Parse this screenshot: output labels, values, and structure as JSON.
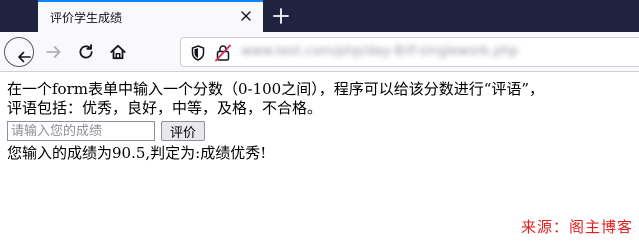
{
  "browser": {
    "tab_title": "评价学生成绩",
    "url_blurred": "www.test.com/php/day-8/if-singlework.php",
    "colors": {
      "tabstrip": "#202340",
      "accent": "#0a84ff"
    }
  },
  "page": {
    "intro_line1": "在一个form表单中输入一个分数（0-100之间），程序可以给该分数进行“评语”，",
    "intro_line2": "评语包括：优秀，良好，中等，及格，不合格。",
    "input_placeholder": "请输入您的成绩",
    "input_value": "",
    "submit_label": "评价",
    "result": "您输入的成绩为90.5,判定为:成绩优秀!"
  },
  "watermark": {
    "text": "来源：阁主博客",
    "color": "#e02020"
  }
}
